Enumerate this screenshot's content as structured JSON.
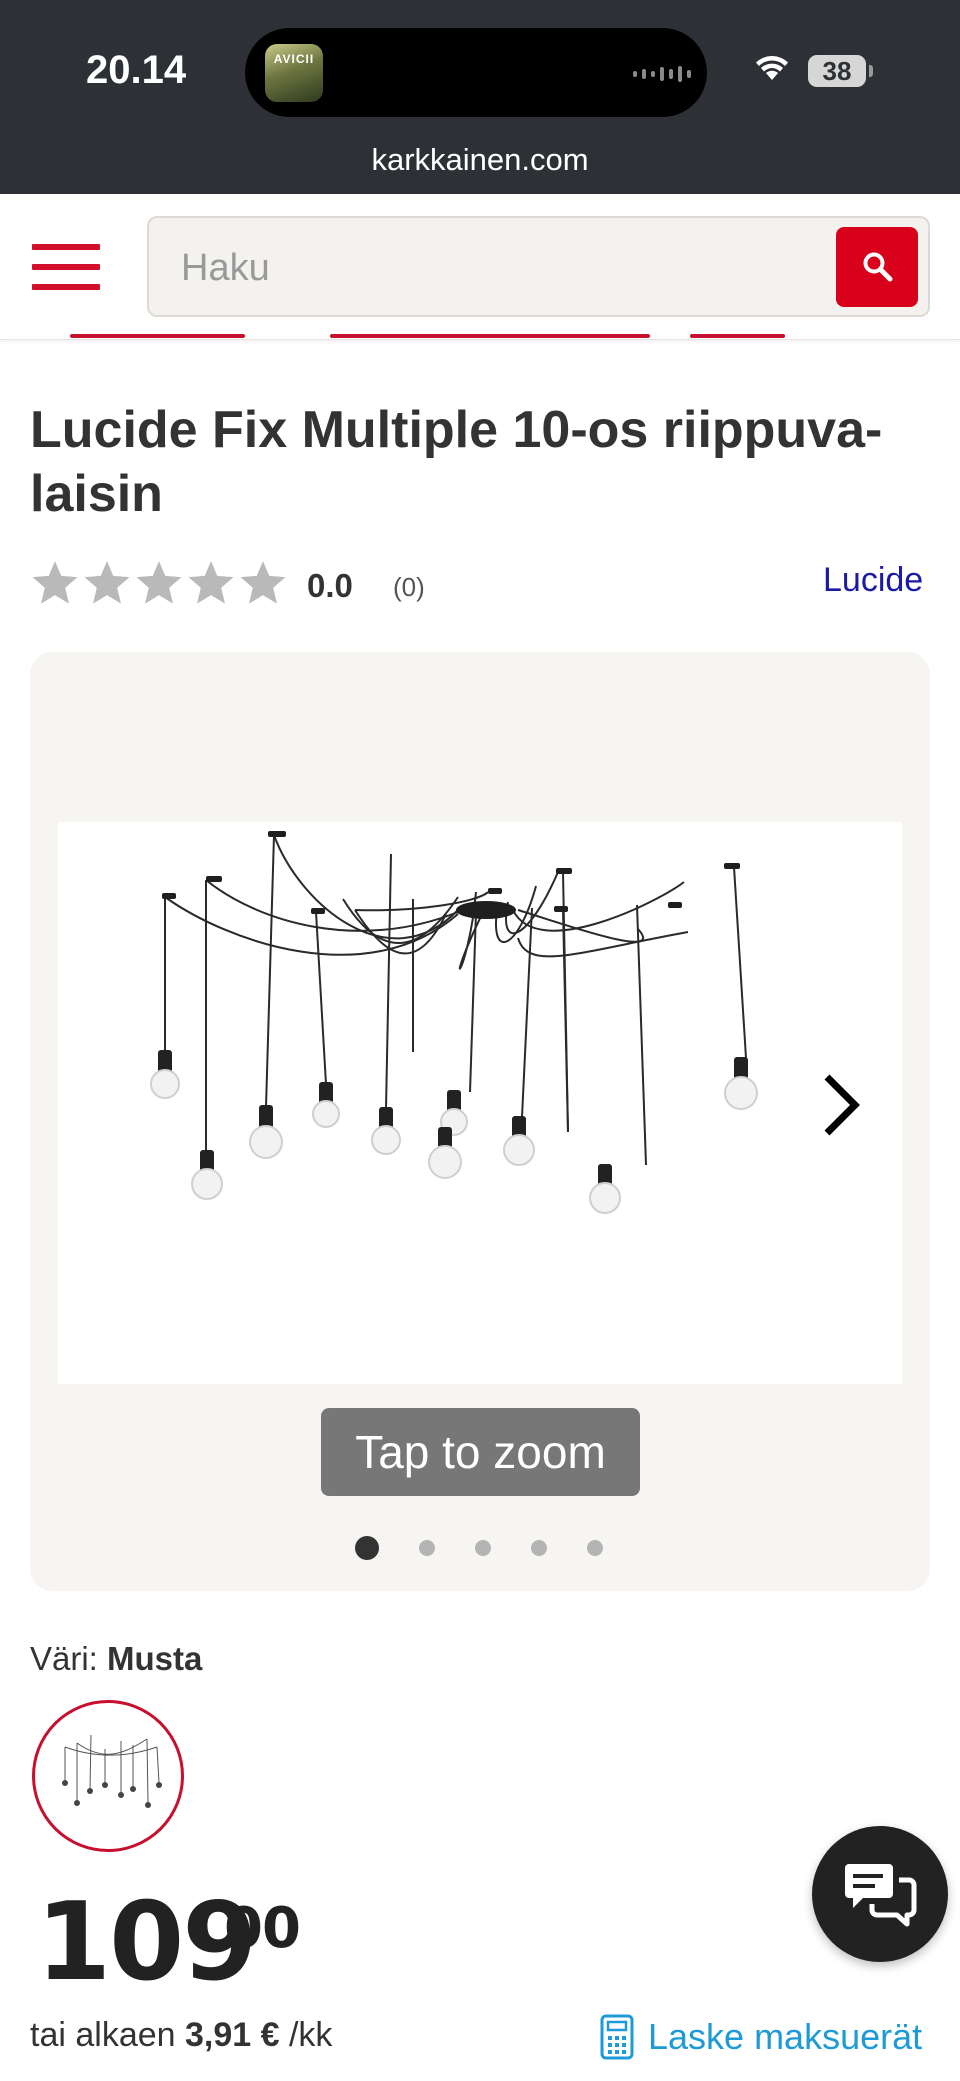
{
  "status_bar": {
    "time": "20.14",
    "now_playing_art_text": "AVICII",
    "battery": "38",
    "url": "karkkainen.com"
  },
  "header": {
    "search": {
      "placeholder": "Haku"
    },
    "accent_color": "#d9001b"
  },
  "product": {
    "title": "Lucide Fix Multiple 10-os riippuva-laisin",
    "rating": {
      "value": "0.0",
      "count": "(0)",
      "stars_filled": 0,
      "stars_total": 5
    },
    "brand": "Lucide"
  },
  "gallery": {
    "zoom_label": "Tap to zoom",
    "slides_total": 5,
    "active_slide": 1
  },
  "variant": {
    "label": "Väri:",
    "value": "Musta"
  },
  "pricing": {
    "price_int": "109",
    "price_dec": "00",
    "installment_prefix": "tai alkaen",
    "installment_amount": "3,91 €",
    "installment_suffix": "/kk",
    "calculator_label": "Laske maksuerät"
  },
  "colors": {
    "brand_red": "#d9001b",
    "link_blue": "#1a1aa6",
    "calc_blue": "#1e9bd7",
    "status_bar_bg": "#2d3035"
  }
}
